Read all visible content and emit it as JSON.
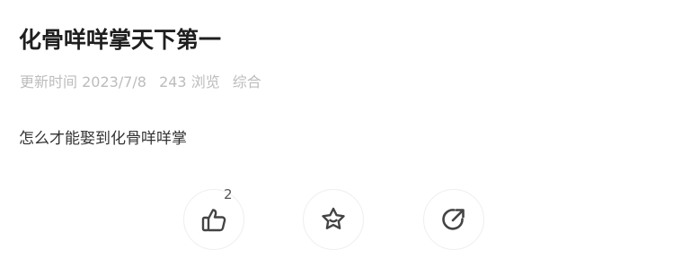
{
  "article": {
    "title": "化骨咩咩掌天下第一",
    "meta": {
      "updated_label": "更新时间",
      "updated_date": "2023/7/8",
      "views": "243 浏览",
      "category": "综合"
    },
    "body": "怎么才能娶到化骨咩咩掌"
  },
  "actions": {
    "like_count": "2",
    "like_icon": "thumbs-up-icon",
    "favorite_icon": "star-icon",
    "share_icon": "share-icon"
  },
  "colors": {
    "title": "#1f1f1f",
    "meta": "#bcbcbc",
    "body": "#333333",
    "icon": "#444444",
    "button_border": "#eeeeee"
  }
}
